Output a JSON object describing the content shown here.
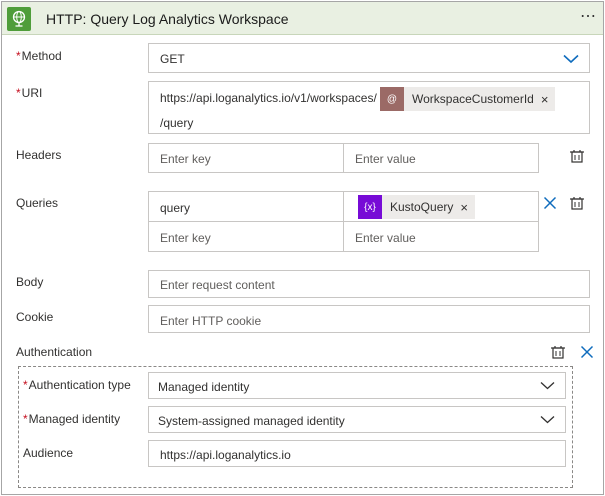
{
  "header": {
    "title": "HTTP: Query Log Analytics Workspace",
    "more": "⋯",
    "icon": "globe-icon",
    "accent": "#4f9d3a"
  },
  "method": {
    "label": "Method",
    "value": "GET"
  },
  "uri": {
    "label": "URI",
    "prefix": "https://api.loganalytics.io/v1/workspaces/",
    "token_icon": "@",
    "token": "WorkspaceCustomerId",
    "suffix": "/query"
  },
  "headers": {
    "label": "Headers",
    "key_placeholder": "Enter key",
    "value_placeholder": "Enter value"
  },
  "queries": {
    "label": "Queries",
    "row1_key": "query",
    "token_icon": "{x}",
    "token": "KustoQuery",
    "key_placeholder": "Enter key",
    "value_placeholder": "Enter value"
  },
  "body": {
    "label": "Body",
    "placeholder": "Enter request content"
  },
  "cookie": {
    "label": "Cookie",
    "placeholder": "Enter HTTP cookie"
  },
  "authentication": {
    "label": "Authentication",
    "type_label": "Authentication type",
    "type_value": "Managed identity",
    "identity_label": "Managed identity",
    "identity_value": "System-assigned managed identity",
    "audience_label": "Audience",
    "audience_value": "https://api.loganalytics.io"
  },
  "required_mark": "*",
  "remove_token": "×",
  "colors": {
    "uri_token": "#9b6a66",
    "var_token": "#770bd6",
    "blue": "#0f6cbd"
  }
}
